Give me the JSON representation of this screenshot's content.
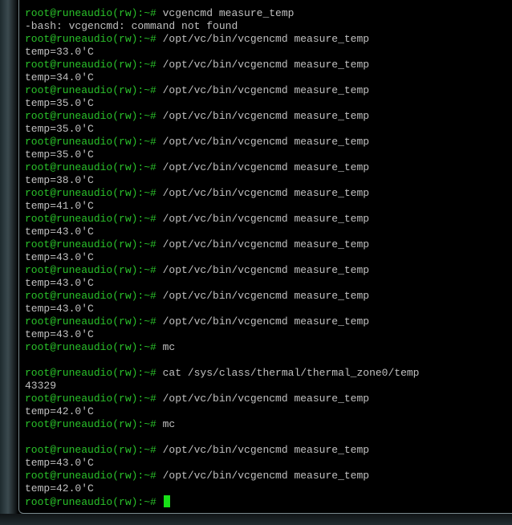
{
  "terminal": {
    "colors": {
      "background": "#000000",
      "prompt": "#2ac22a",
      "text": "#c0c0c0",
      "cursor": "#18e018"
    },
    "cursor_style": "block",
    "lines": [
      {
        "prompt": "root@runeaudio(rw):~#",
        "text": " vcgencmd measure_temp"
      },
      {
        "prompt": "",
        "text": "-bash: vcgencmd: command not found"
      },
      {
        "prompt": "root@runeaudio(rw):~#",
        "text": " /opt/vc/bin/vcgencmd measure_temp"
      },
      {
        "prompt": "",
        "text": "temp=33.0'C"
      },
      {
        "prompt": "root@runeaudio(rw):~#",
        "text": " /opt/vc/bin/vcgencmd measure_temp"
      },
      {
        "prompt": "",
        "text": "temp=34.0'C"
      },
      {
        "prompt": "root@runeaudio(rw):~#",
        "text": " /opt/vc/bin/vcgencmd measure_temp"
      },
      {
        "prompt": "",
        "text": "temp=35.0'C"
      },
      {
        "prompt": "root@runeaudio(rw):~#",
        "text": " /opt/vc/bin/vcgencmd measure_temp"
      },
      {
        "prompt": "",
        "text": "temp=35.0'C"
      },
      {
        "prompt": "root@runeaudio(rw):~#",
        "text": " /opt/vc/bin/vcgencmd measure_temp"
      },
      {
        "prompt": "",
        "text": "temp=35.0'C"
      },
      {
        "prompt": "root@runeaudio(rw):~#",
        "text": " /opt/vc/bin/vcgencmd measure_temp"
      },
      {
        "prompt": "",
        "text": "temp=38.0'C"
      },
      {
        "prompt": "root@runeaudio(rw):~#",
        "text": " /opt/vc/bin/vcgencmd measure_temp"
      },
      {
        "prompt": "",
        "text": "temp=41.0'C"
      },
      {
        "prompt": "root@runeaudio(rw):~#",
        "text": " /opt/vc/bin/vcgencmd measure_temp"
      },
      {
        "prompt": "",
        "text": "temp=43.0'C"
      },
      {
        "prompt": "root@runeaudio(rw):~#",
        "text": " /opt/vc/bin/vcgencmd measure_temp"
      },
      {
        "prompt": "",
        "text": "temp=43.0'C"
      },
      {
        "prompt": "root@runeaudio(rw):~#",
        "text": " /opt/vc/bin/vcgencmd measure_temp"
      },
      {
        "prompt": "",
        "text": "temp=43.0'C"
      },
      {
        "prompt": "root@runeaudio(rw):~#",
        "text": " /opt/vc/bin/vcgencmd measure_temp"
      },
      {
        "prompt": "",
        "text": "temp=43.0'C"
      },
      {
        "prompt": "root@runeaudio(rw):~#",
        "text": " /opt/vc/bin/vcgencmd measure_temp"
      },
      {
        "prompt": "",
        "text": "temp=43.0'C"
      },
      {
        "prompt": "root@runeaudio(rw):~#",
        "text": " mc"
      },
      {
        "prompt": "",
        "text": ""
      },
      {
        "prompt": "root@runeaudio(rw):~#",
        "text": " cat /sys/class/thermal/thermal_zone0/temp"
      },
      {
        "prompt": "",
        "text": "43329"
      },
      {
        "prompt": "root@runeaudio(rw):~#",
        "text": " /opt/vc/bin/vcgencmd measure_temp"
      },
      {
        "prompt": "",
        "text": "temp=42.0'C"
      },
      {
        "prompt": "root@runeaudio(rw):~#",
        "text": " mc"
      },
      {
        "prompt": "",
        "text": ""
      },
      {
        "prompt": "root@runeaudio(rw):~#",
        "text": " /opt/vc/bin/vcgencmd measure_temp"
      },
      {
        "prompt": "",
        "text": "temp=43.0'C"
      },
      {
        "prompt": "root@runeaudio(rw):~#",
        "text": " /opt/vc/bin/vcgencmd measure_temp"
      },
      {
        "prompt": "",
        "text": "temp=42.0'C"
      },
      {
        "prompt": "root@runeaudio(rw):~#",
        "text": " ",
        "cursor": true
      }
    ]
  }
}
